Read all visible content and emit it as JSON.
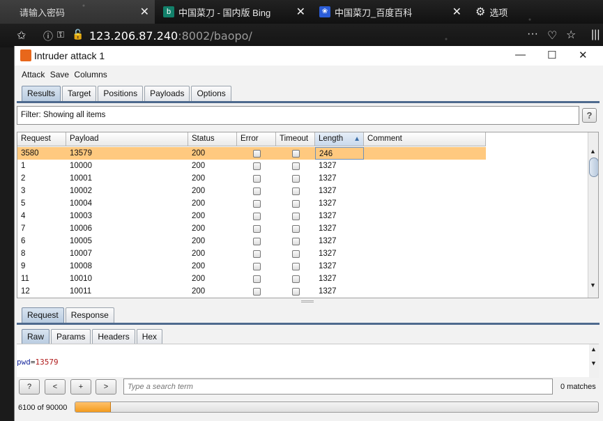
{
  "browser": {
    "tabs": [
      {
        "label": "请输入密码",
        "active": true
      },
      {
        "label": "中国菜刀 - 国内版 Bing",
        "active": false
      },
      {
        "label": "中国菜刀_百度百科",
        "active": false
      },
      {
        "label": "选项",
        "active": false
      }
    ],
    "url_host": "123.206.87.240",
    "url_rest": ":8002/baopo/"
  },
  "window": {
    "title": "Intruder attack 1",
    "menu": [
      "Attack",
      "Save",
      "Columns"
    ],
    "tabs": [
      "Results",
      "Target",
      "Positions",
      "Payloads",
      "Options"
    ],
    "selected_tab": "Results"
  },
  "filter": {
    "text": "Filter:  Showing all items",
    "help_label": "?"
  },
  "table": {
    "columns": [
      "Request",
      "Payload",
      "Status",
      "Error",
      "Timeout",
      "Length",
      "Comment"
    ],
    "sorted_column": "Length",
    "rows": [
      {
        "request": "3580",
        "payload": "13579",
        "status": "200",
        "length": "246",
        "selected": true
      },
      {
        "request": "1",
        "payload": "10000",
        "status": "200",
        "length": "1327"
      },
      {
        "request": "2",
        "payload": "10001",
        "status": "200",
        "length": "1327"
      },
      {
        "request": "3",
        "payload": "10002",
        "status": "200",
        "length": "1327"
      },
      {
        "request": "5",
        "payload": "10004",
        "status": "200",
        "length": "1327"
      },
      {
        "request": "4",
        "payload": "10003",
        "status": "200",
        "length": "1327"
      },
      {
        "request": "7",
        "payload": "10006",
        "status": "200",
        "length": "1327"
      },
      {
        "request": "6",
        "payload": "10005",
        "status": "200",
        "length": "1327"
      },
      {
        "request": "8",
        "payload": "10007",
        "status": "200",
        "length": "1327"
      },
      {
        "request": "9",
        "payload": "10008",
        "status": "200",
        "length": "1327"
      },
      {
        "request": "11",
        "payload": "10010",
        "status": "200",
        "length": "1327"
      },
      {
        "request": "12",
        "payload": "10011",
        "status": "200",
        "length": "1327"
      }
    ]
  },
  "message": {
    "tabs": [
      "Request",
      "Response"
    ],
    "selected_tab": "Request",
    "view_tabs": [
      "Raw",
      "Params",
      "Headers",
      "Hex"
    ],
    "selected_view": "Raw",
    "body_key": "pwd",
    "body_sep": "=",
    "body_value": "13579"
  },
  "search": {
    "help_label": "?",
    "prev_label": "<",
    "add_label": "+",
    "next_label": ">",
    "placeholder": "Type a search term",
    "matches": "0 matches"
  },
  "progress": {
    "text": "6100 of 90000",
    "done": 6100,
    "total": 90000
  },
  "colors": {
    "selected_row": "#ffc97f",
    "progress_fill": "#f39b1e",
    "accent_tab": "#4e6a8e"
  }
}
